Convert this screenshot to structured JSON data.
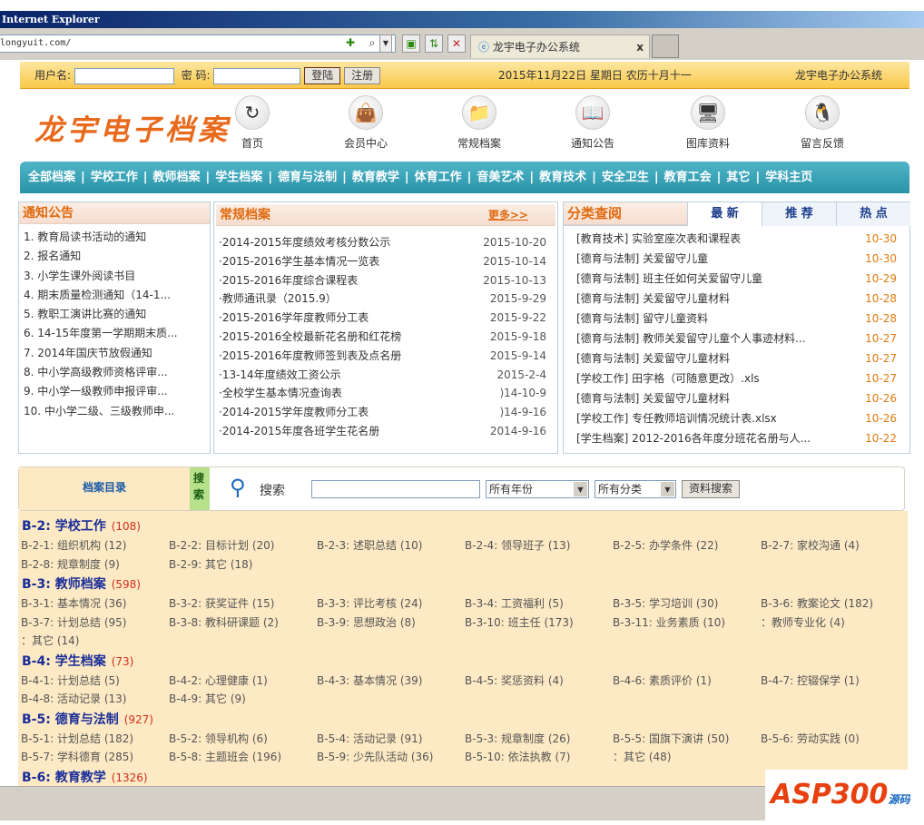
{
  "browser": {
    "title": "Internet Explorer",
    "address": "longyuit.com/",
    "tab_title": "龙宇电子办公系统",
    "tab_close": "x"
  },
  "login": {
    "user_label": "用户名:",
    "pass_label": "密 码:",
    "login_btn": "登陆",
    "register_btn": "注册",
    "date": "2015年11月22日 星期日 农历十月十一",
    "site": "龙宇电子办公系统"
  },
  "logo": "龙宇电子档案",
  "nav_icons": [
    {
      "label": "首页",
      "icon": "home-icon",
      "glyph": "↻"
    },
    {
      "label": "会员中心",
      "icon": "bag-icon",
      "glyph": "👜"
    },
    {
      "label": "常规档案",
      "icon": "folder-icon",
      "glyph": "📁"
    },
    {
      "label": "通知公告",
      "icon": "book-icon",
      "glyph": "📖"
    },
    {
      "label": "图库资料",
      "icon": "monitor-icon",
      "glyph": "🖥"
    },
    {
      "label": "留言反馈",
      "icon": "penguin-icon",
      "glyph": "🐧"
    }
  ],
  "mainnav": [
    "全部档案",
    "学校工作",
    "教师档案",
    "学生档案",
    "德育与法制",
    "教育教学",
    "体育工作",
    "音美艺术",
    "教育技术",
    "安全卫生",
    "教育工会",
    "其它",
    "学科主页"
  ],
  "notice": {
    "title": "通知公告",
    "items": [
      "1. 教育局读书活动的通知",
      "2. 报名通知",
      "3. 小学生课外阅读书目",
      "4. 期末质量检测通知（14-1...",
      "5. 教职工演讲比赛的通知",
      "6. 14-15年度第一学期期末质...",
      "7. 2014年国庆节放假通知",
      "8. 中小学高级教师资格评审...",
      "9. 中小学一级教师申报评审...",
      "10. 中小学二级、三级教师申..."
    ]
  },
  "regular": {
    "title": "常规档案",
    "more": "更多>>",
    "items": [
      {
        "t": "·2014-2015年度绩效考核分数公示",
        "d": "2015-10-20"
      },
      {
        "t": "·2015-2016学生基本情况一览表",
        "d": "2015-10-14"
      },
      {
        "t": "·2015-2016年度综合课程表",
        "d": "2015-10-13"
      },
      {
        "t": "·教师通讯录（2015.9）",
        "d": "2015-9-29"
      },
      {
        "t": "·2015-2016学年度教师分工表",
        "d": "2015-9-22"
      },
      {
        "t": "·2015-2016全校最新花名册和红花榜",
        "d": "2015-9-18"
      },
      {
        "t": "·2015-2016年度教师签到表及点名册",
        "d": "2015-9-14"
      },
      {
        "t": "·13-14年度绩效工资公示",
        "d": "2015-2-4"
      },
      {
        "t": "·全校学生基本情况查询表",
        "d": ")14-10-9"
      },
      {
        "t": "·2014-2015学年度教师分工表",
        "d": ")14-9-16"
      },
      {
        "t": "·2014-2015年度各班学生花名册",
        "d": "2014-9-16"
      }
    ]
  },
  "browse": {
    "title": "分类查阅",
    "tabs": [
      "最 新",
      "推 荐",
      "热 点"
    ],
    "items": [
      {
        "t": "[教育技术] 实验室座次表和课程表",
        "d": "10-30"
      },
      {
        "t": "[德育与法制] 关爱留守儿童",
        "d": "10-30"
      },
      {
        "t": "[德育与法制] 班主任如何关爱留守儿童",
        "d": "10-29"
      },
      {
        "t": "[德育与法制] 关爱留守儿童材料",
        "d": "10-28"
      },
      {
        "t": "[德育与法制] 留守儿童资料",
        "d": "10-28"
      },
      {
        "t": "[德育与法制] 教师关爱留守儿童个人事迹材料...",
        "d": "10-27"
      },
      {
        "t": "[德育与法制] 关爱留守儿童材料",
        "d": "10-27"
      },
      {
        "t": "[学校工作] 田字格（可随意更改）.xls",
        "d": "10-27"
      },
      {
        "t": "[德育与法制] 关爱留守儿童材料",
        "d": "10-26"
      },
      {
        "t": "[学校工作] 专任教师培训情况统计表.xlsx",
        "d": "10-26"
      },
      {
        "t": "[学生档案] 2012-2016各年度分班花名册与人...",
        "d": "10-22"
      }
    ]
  },
  "search": {
    "dir_label": "档案目录",
    "side_tag": "搜索",
    "label": "搜索",
    "year": "所有年份",
    "category": "所有分类",
    "button": "资料搜索"
  },
  "categories": [
    {
      "head": "B-2: 学校工作",
      "count": "(108)",
      "rows": [
        [
          "B-2-1: 组织机构 (12)",
          "B-2-2: 目标计划 (20)",
          "B-2-3: 述职总结 (10)",
          "B-2-4: 领导班子 (13)",
          "B-2-5: 办学条件 (22)",
          "B-2-7: 家校沟通 (4)"
        ],
        [
          "B-2-8: 规章制度 (9)",
          "B-2-9: 其它 (18)"
        ]
      ]
    },
    {
      "head": "B-3: 教师档案",
      "count": "(598)",
      "rows": [
        [
          "B-3-1: 基本情况 (36)",
          "B-3-2: 获奖证件 (15)",
          "B-3-3: 评比考核 (24)",
          "B-3-4: 工资福利 (5)",
          "B-3-5: 学习培训 (30)",
          "B-3-6: 教案论文 (182)"
        ],
        [
          "B-3-7: 计划总结 (95)",
          "B-3-8: 教科研课题 (2)",
          "B-3-9: 思想政治 (8)",
          "B-3-10: 班主任 (173)",
          "B-3-11: 业务素质 (10)",
          "：教师专业化 (4)"
        ],
        [
          "：其它 (14)"
        ]
      ]
    },
    {
      "head": "B-4: 学生档案",
      "count": "(73)",
      "rows": [
        [
          "B-4-1: 计划总结 (5)",
          "B-4-2: 心理健康 (1)",
          "B-4-3: 基本情况 (39)",
          "B-4-5: 奖惩资料 (4)",
          "B-4-6: 素质评价 (1)",
          "B-4-7: 控辍保学 (1)"
        ],
        [
          "B-4-8: 活动记录 (13)",
          "B-4-9: 其它 (9)"
        ]
      ]
    },
    {
      "head": "B-5: 德育与法制",
      "count": "(927)",
      "rows": [
        [
          "B-5-1: 计划总结 (182)",
          "B-5-2: 领导机构 (6)",
          "B-5-4: 活动记录 (91)",
          "B-5-3: 规章制度 (26)",
          "B-5-5: 国旗下演讲 (50)",
          "B-5-6: 劳动实践 (0)"
        ],
        [
          "B-5-7: 学科德育 (285)",
          "B-5-8: 主题班会 (196)",
          "B-5-9: 少先队活动 (36)",
          "B-5-10: 依法执教 (7)",
          "：其它 (48)"
        ]
      ]
    },
    {
      "head": "B-6: 教育教学",
      "count": "(1326)",
      "rows": []
    }
  ],
  "watermark": {
    "brand": "ASP300",
    "tag": "源码"
  }
}
